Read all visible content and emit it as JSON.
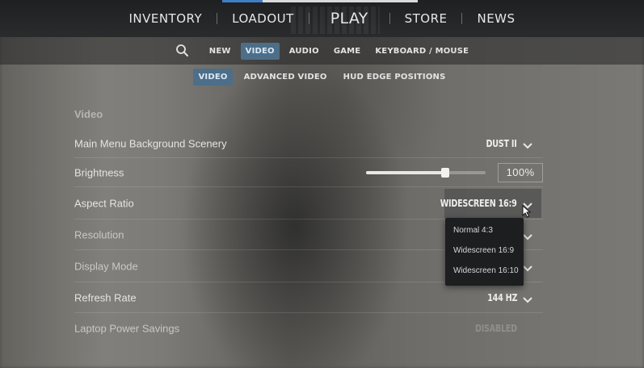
{
  "top_nav": {
    "items": [
      "INVENTORY",
      "LOADOUT",
      "PLAY",
      "STORE",
      "NEWS"
    ]
  },
  "settings_tabs": {
    "items": [
      "NEW",
      "VIDEO",
      "AUDIO",
      "GAME",
      "KEYBOARD / MOUSE"
    ],
    "active": "VIDEO"
  },
  "video_subtabs": {
    "items": [
      "VIDEO",
      "ADVANCED VIDEO",
      "HUD EDGE POSITIONS"
    ],
    "active": "VIDEO"
  },
  "section": {
    "title": "Video"
  },
  "settings": {
    "main_menu_scenery": {
      "label": "Main Menu Background Scenery",
      "value": "DUST II"
    },
    "brightness": {
      "label": "Brightness",
      "value": "100%",
      "level": 0.66
    },
    "aspect_ratio": {
      "label": "Aspect Ratio",
      "value": "WIDESCREEN 16:9"
    },
    "resolution": {
      "label": "Resolution"
    },
    "display_mode": {
      "label": "Display Mode"
    },
    "refresh_rate": {
      "label": "Refresh Rate",
      "value": "144 HZ"
    },
    "laptop_power": {
      "label": "Laptop Power Savings",
      "value": "DISABLED"
    }
  },
  "aspect_ratio_options": [
    "Normal 4:3",
    "Widescreen 16:9",
    "Widescreen 16:10"
  ],
  "icons": {
    "search": "search-icon",
    "chevron": "chevron-down-icon",
    "cursor": "mouse-pointer-icon"
  },
  "colors": {
    "accent_blue": "#3d7fc7",
    "active_tab": "#4d6e88"
  }
}
